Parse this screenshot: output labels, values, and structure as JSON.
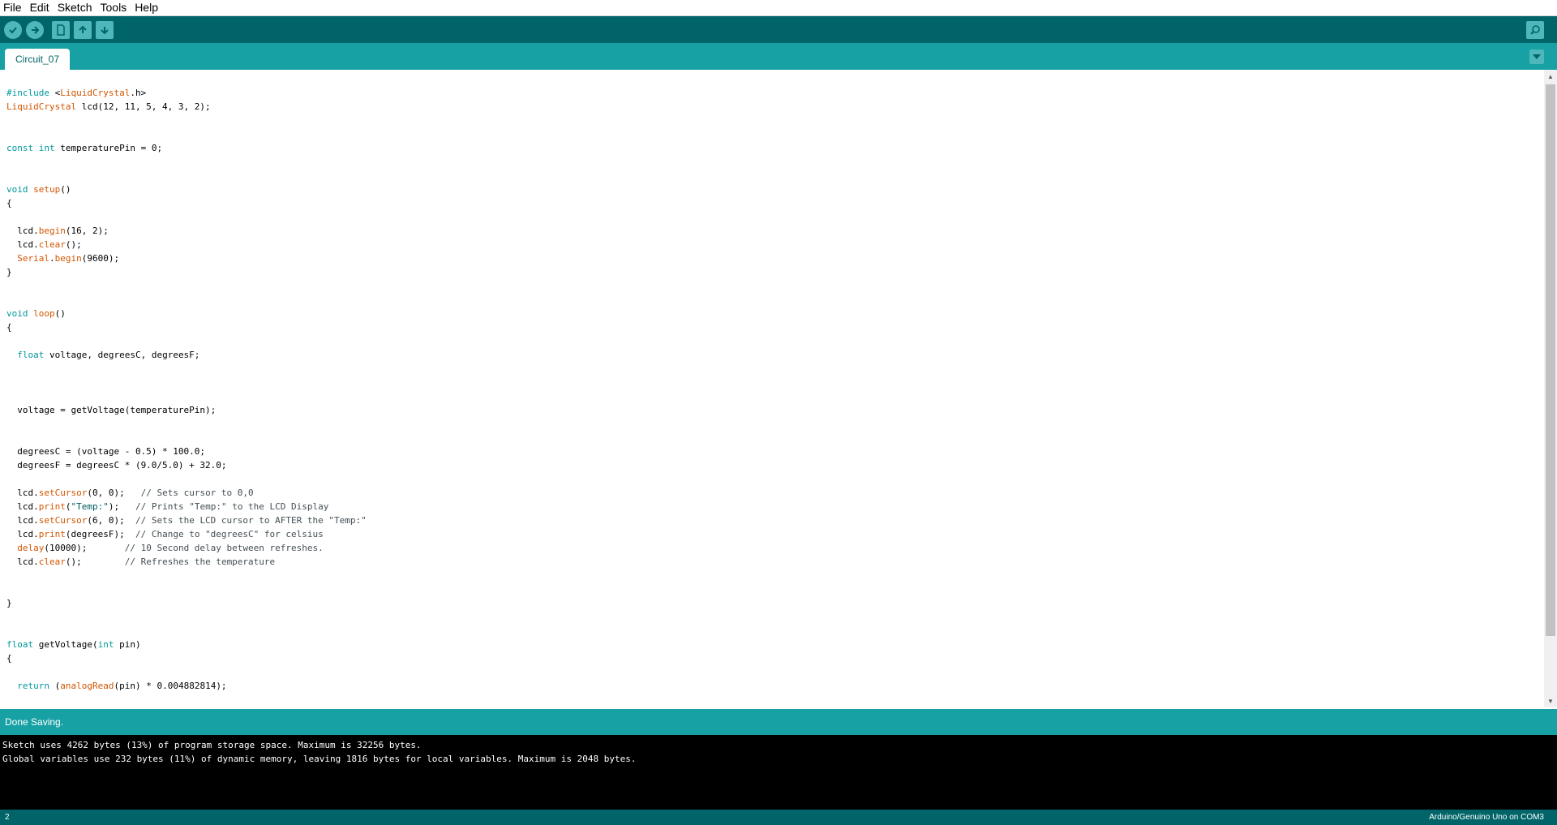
{
  "menu": [
    "File",
    "Edit",
    "Sketch",
    "Tools",
    "Help"
  ],
  "toolbar": {
    "buttons": [
      {
        "name": "verify",
        "icon": "checkmark-icon"
      },
      {
        "name": "upload",
        "icon": "arrow-right-icon"
      },
      {
        "name": "new",
        "icon": "new-file-icon"
      },
      {
        "name": "open",
        "icon": "arrow-up-icon"
      },
      {
        "name": "save",
        "icon": "arrow-down-icon"
      }
    ],
    "serial_monitor_icon": "magnifier-icon"
  },
  "tab": {
    "label": "Circuit_07"
  },
  "code_lines": [
    "#include <LiquidCrystal.h>",
    "LiquidCrystal lcd(12, 11, 5, 4, 3, 2);",
    "",
    "",
    "const int temperaturePin = 0;",
    "",
    "",
    "void setup()",
    "{",
    "",
    "  lcd.begin(16, 2);",
    "  lcd.clear();",
    "  Serial.begin(9600);",
    "}",
    "",
    "",
    "void loop()",
    "{",
    "",
    "  float voltage, degreesC, degreesF;",
    "",
    "",
    "",
    "  voltage = getVoltage(temperaturePin);",
    "",
    "",
    "  degreesC = (voltage - 0.5) * 100.0;",
    "  degreesF = degreesC * (9.0/5.0) + 32.0;",
    "",
    "  lcd.setCursor(0, 0);   // Sets cursor to 0,0",
    "  lcd.print(\"Temp:\");   // Prints \"Temp:\" to the LCD Display",
    "  lcd.setCursor(6, 0);  // Sets the LCD cursor to AFTER the \"Temp:\"",
    "  lcd.print(degreesF);  // Change to \"degreesC\" for celsius",
    "  delay(10000);       // 10 Second delay between refreshes.",
    "  lcd.clear();        // Refreshes the temperature",
    "",
    "",
    "}",
    "",
    "",
    "float getVoltage(int pin)",
    "{",
    "",
    "  return (analogRead(pin) * 0.004882814);"
  ],
  "status": {
    "message": "Done Saving."
  },
  "console": [
    "Sketch uses 4262 bytes (13%) of program storage space. Maximum is 32256 bytes.",
    "Global variables use 232 bytes (11%) of dynamic memory, leaving 1816 bytes for local variables. Maximum is 2048 bytes."
  ],
  "footer": {
    "line_number": "2",
    "board": "Arduino/Genuino Uno on COM3"
  },
  "colors": {
    "toolbar_bg": "#006468",
    "tabbar_bg": "#17a1a5",
    "button_bg": "#4db7bb",
    "keyword": "#00979c",
    "function": "#d35400",
    "comment": "#434f54"
  }
}
